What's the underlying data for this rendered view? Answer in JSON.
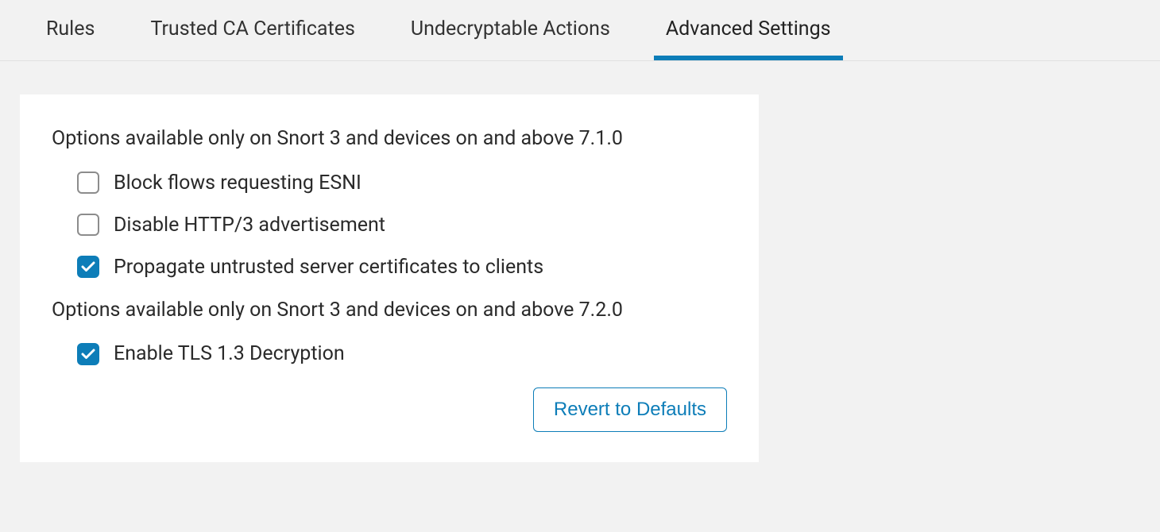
{
  "tabs": [
    {
      "label": "Rules"
    },
    {
      "label": "Trusted CA Certificates"
    },
    {
      "label": "Undecryptable Actions"
    },
    {
      "label": "Advanced Settings"
    }
  ],
  "activeTabIndex": 3,
  "sections": [
    {
      "heading": "Options available only on Snort 3 and devices on and above 7.1.0",
      "options": [
        {
          "label": "Block flows requesting ESNI",
          "checked": false
        },
        {
          "label": "Disable HTTP/3 advertisement",
          "checked": false
        },
        {
          "label": "Propagate untrusted server certificates to clients",
          "checked": true
        }
      ]
    },
    {
      "heading": "Options available only on Snort 3 and devices on and above 7.2.0",
      "options": [
        {
          "label": "Enable TLS 1.3 Decryption",
          "checked": true
        }
      ]
    }
  ],
  "revert_label": "Revert to Defaults"
}
